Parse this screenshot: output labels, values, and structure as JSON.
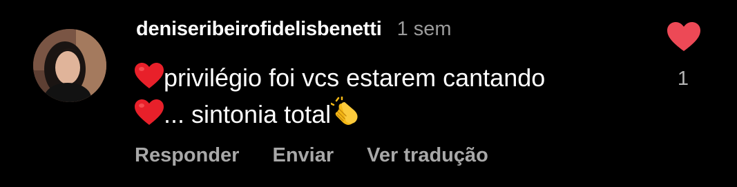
{
  "comment": {
    "avatar_icon": "profile-photo",
    "username": "deniseribeirofidelisbenetti",
    "timestamp": "1 sem",
    "text_line1": "privilégio foi vcs estarem cantando",
    "text_line2": "... sintonia total",
    "leading_emoji": "red-heart-icon",
    "trailing_emoji": "clapping-hands-icon"
  },
  "actions": {
    "reply_label": "Responder",
    "send_label": "Enviar",
    "translate_label": "Ver tradução"
  },
  "like": {
    "icon": "heart-icon",
    "count": "1",
    "color": "#ed4956"
  },
  "colors": {
    "background": "#000000",
    "username": "#ffffff",
    "muted": "#9b9b9b",
    "action": "#a8a8a8"
  }
}
